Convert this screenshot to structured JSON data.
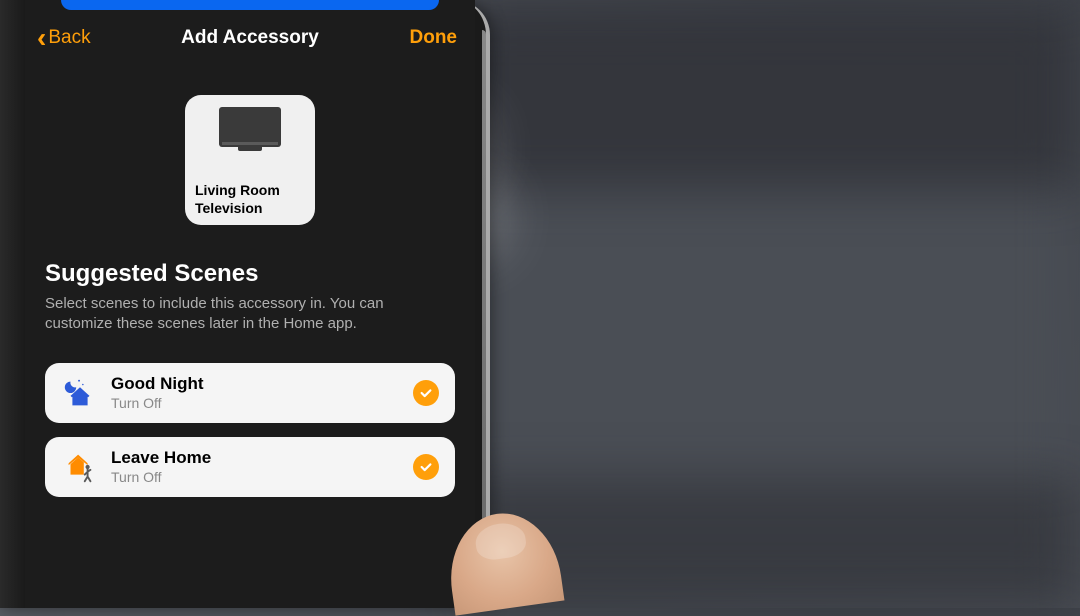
{
  "nav": {
    "back_label": "Back",
    "title": "Add Accessory",
    "done_label": "Done"
  },
  "accessory": {
    "name": "Living Room Television",
    "icon": "television-icon"
  },
  "section": {
    "title": "Suggested Scenes",
    "description": "Select scenes to include this accessory in. You can customize these scenes later in the Home app."
  },
  "scenes": [
    {
      "title": "Good Night",
      "subtitle": "Turn Off",
      "icon": "night-house-icon",
      "checked": true
    },
    {
      "title": "Leave Home",
      "subtitle": "Turn Off",
      "icon": "leave-house-icon",
      "checked": true
    }
  ],
  "colors": {
    "accent": "#ff9f0a",
    "scene_blue": "#2d5bd8",
    "scene_orange": "#ff8c00"
  }
}
